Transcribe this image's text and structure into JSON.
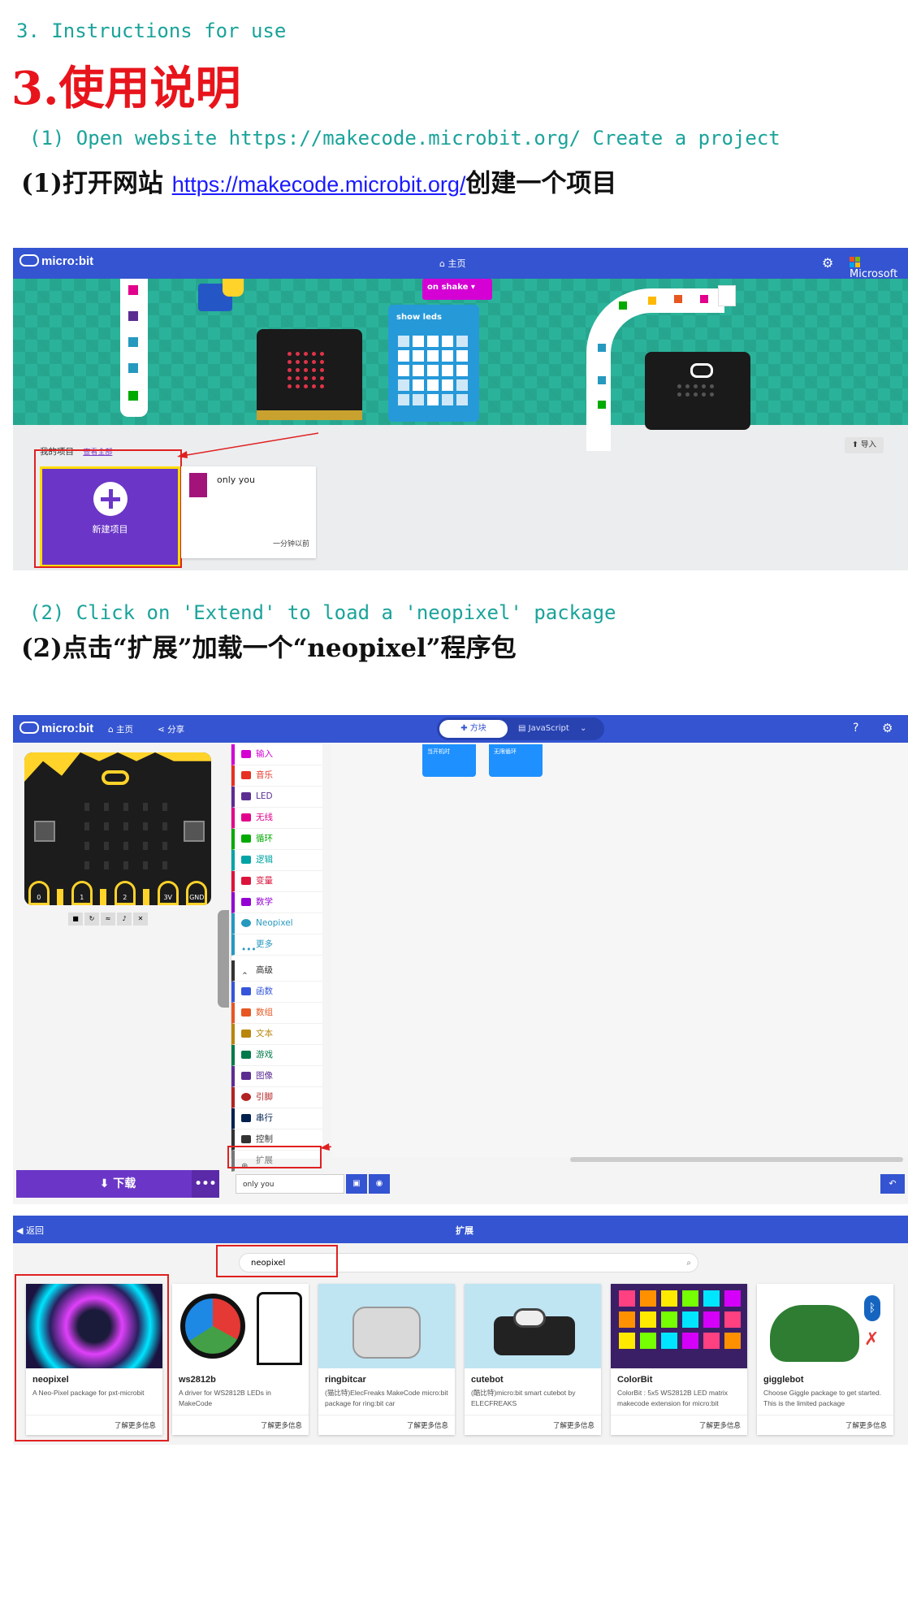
{
  "heading": {
    "en": "3. Instructions for use",
    "cn_number": "3.",
    "cn_title": "使用说明"
  },
  "step1": {
    "en": "(1) Open website https://makecode.microbit.org/ Create a project",
    "cn_prefix": "(1)打开网站",
    "link": "https://makecode.microbit.org/",
    "cn_suffix": "创建一个项目"
  },
  "step2": {
    "en": "(2) Click on 'Extend' to load a 'neopixel' package",
    "cn": "(2)点击“扩展”加载一个“neopixel”程序包"
  },
  "home_screen": {
    "logo": "micro:bit",
    "home_tab": "主页",
    "microsoft": "Microsoft",
    "on_shake": "on shake ▾",
    "show_leds": "show leds",
    "my_projects": "我的项目",
    "view_all": "查看全部",
    "import": "导入",
    "new_project": "新建项目",
    "project_name": "only you",
    "project_time": "一分钟以前"
  },
  "editor": {
    "logo": "micro:bit",
    "home": "主页",
    "share": "分享",
    "blocks_tab": "方块",
    "js_tab": "JavaScript",
    "block_start": "当开机时",
    "block_forever": "无限循环",
    "pins": [
      "0",
      "1",
      "2",
      "3V",
      "GND"
    ],
    "toolbox": [
      {
        "label": "输入",
        "color": "#d400d4"
      },
      {
        "label": "音乐",
        "color": "#e63022"
      },
      {
        "label": "LED",
        "color": "#5c2d91"
      },
      {
        "label": "无线",
        "color": "#e3008c"
      },
      {
        "label": "循环",
        "color": "#00aa00"
      },
      {
        "label": "逻辑",
        "color": "#00a4a6"
      },
      {
        "label": "变量",
        "color": "#dc143c"
      },
      {
        "label": "数学",
        "color": "#9400d3"
      },
      {
        "label": "Neopixel",
        "color": "#2699bf"
      },
      {
        "label": "更多",
        "color": "#2699bf"
      },
      {
        "label": "高级",
        "color": "#333333"
      },
      {
        "label": "函数",
        "color": "#3455db"
      },
      {
        "label": "数组",
        "color": "#e65722"
      },
      {
        "label": "文本",
        "color": "#b8860b"
      },
      {
        "label": "游戏",
        "color": "#007a4b"
      },
      {
        "label": "图像",
        "color": "#5c2d91"
      },
      {
        "label": "引脚",
        "color": "#b22222"
      },
      {
        "label": "串行",
        "color": "#002050"
      },
      {
        "label": "控制",
        "color": "#333333"
      },
      {
        "label": "扩展",
        "color": "#777777"
      }
    ],
    "download": "下载",
    "project_name_value": "only you"
  },
  "extensions": {
    "back": "返回",
    "title": "扩展",
    "search_value": "neopixel",
    "cards": [
      {
        "name": "neopixel",
        "desc": "A Neo-Pixel package for pxt-microbit",
        "more": "了解更多信息",
        "color": "#2a1f5e"
      },
      {
        "name": "ws2812b",
        "desc": "A driver for WS2812B LEDs in MakeCode",
        "more": "了解更多信息",
        "color": "#ffffff"
      },
      {
        "name": "ringbitcar",
        "desc": "(猫比特)ElecFreaks MakeCode micro:bit package for ring:bit car",
        "more": "了解更多信息",
        "color": "#bfe4f2"
      },
      {
        "name": "cutebot",
        "desc": "(酷比特)micro:bit smart cutebot by ELECFREAKS",
        "more": "了解更多信息",
        "color": "#bfe4f2"
      },
      {
        "name": "ColorBit",
        "desc": "ColorBit : 5x5 WS2812B LED matrix makecode extension for micro:bit",
        "more": "了解更多信息",
        "color": "#3b1f66"
      },
      {
        "name": "gigglebot",
        "desc": "Choose Giggle package to get started. This is the limited package",
        "more": "了解更多信息",
        "color": "#ffffff"
      }
    ]
  }
}
